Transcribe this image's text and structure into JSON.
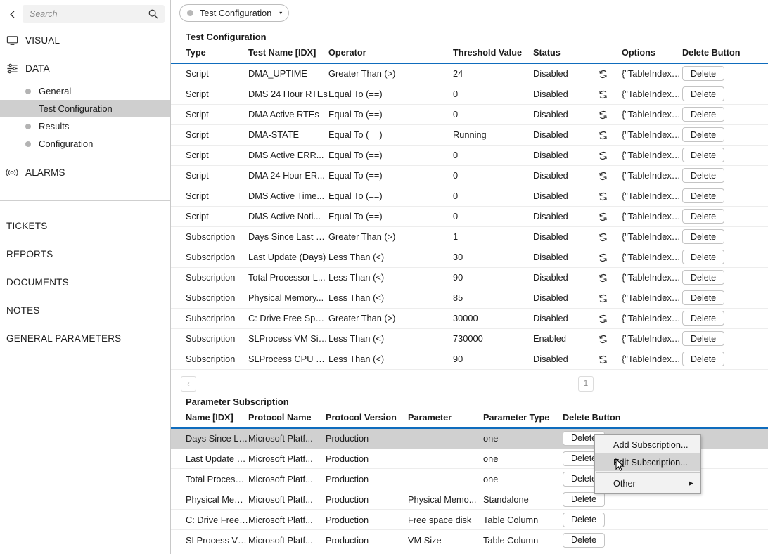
{
  "sidebar": {
    "back_icon": "chevron-left-icon",
    "search": {
      "value": "",
      "placeholder": "Search",
      "icon": "search-icon"
    },
    "sections": [
      {
        "label": "VISUAL",
        "icon": "monitor-icon"
      },
      {
        "label": "DATA",
        "icon": "sliders-icon"
      }
    ],
    "data_children": [
      {
        "label": "General",
        "selected": false
      },
      {
        "label": "Test Configuration",
        "selected": true
      },
      {
        "label": "Results",
        "selected": false
      },
      {
        "label": "Configuration",
        "selected": false
      }
    ],
    "alarms": {
      "label": "ALARMS",
      "icon": "alarm-icon"
    },
    "flat_items": [
      {
        "label": "TICKETS"
      },
      {
        "label": "REPORTS"
      },
      {
        "label": "DOCUMENTS"
      },
      {
        "label": "NOTES"
      },
      {
        "label": "GENERAL PARAMETERS"
      }
    ]
  },
  "topbar": {
    "pill_label": "Test Configuration",
    "pill_caret": "▾"
  },
  "test_configuration": {
    "title": "Test Configuration",
    "columns": [
      "Type",
      "Test Name [IDX]",
      "Operator",
      "Threshold Value",
      "Status",
      "",
      "Options",
      "Delete Button"
    ],
    "delete_label": "Delete",
    "options_value": "{\"TableIndexFilt...",
    "refresh_icon": "refresh-icon",
    "rows": [
      {
        "type": "Script",
        "name": "DMA_UPTIME",
        "operator": "Greater Than (>)",
        "threshold": "24",
        "status": "Disabled"
      },
      {
        "type": "Script",
        "name": "DMS 24 Hour RTEs",
        "operator": "Equal To (==)",
        "threshold": "0",
        "status": "Disabled"
      },
      {
        "type": "Script",
        "name": "DMA Active RTEs",
        "operator": "Equal To (==)",
        "threshold": "0",
        "status": "Disabled"
      },
      {
        "type": "Script",
        "name": "DMA-STATE",
        "operator": "Equal To (==)",
        "threshold": "Running",
        "status": "Disabled"
      },
      {
        "type": "Script",
        "name": "DMS Active ERR...",
        "operator": "Equal To (==)",
        "threshold": "0",
        "status": "Disabled"
      },
      {
        "type": "Script",
        "name": "DMA 24 Hour ER...",
        "operator": "Equal To (==)",
        "threshold": "0",
        "status": "Disabled"
      },
      {
        "type": "Script",
        "name": "DMS Active Time...",
        "operator": "Equal To (==)",
        "threshold": "0",
        "status": "Disabled"
      },
      {
        "type": "Script",
        "name": "DMS Active Noti...",
        "operator": "Equal To (==)",
        "threshold": "0",
        "status": "Disabled"
      },
      {
        "type": "Subscription",
        "name": "Days Since Last R...",
        "operator": "Greater Than (>)",
        "threshold": "1",
        "status": "Disabled"
      },
      {
        "type": "Subscription",
        "name": "Last Update (Days)",
        "operator": "Less Than (<)",
        "threshold": "30",
        "status": "Disabled"
      },
      {
        "type": "Subscription",
        "name": "Total Processor L...",
        "operator": "Less Than (<)",
        "threshold": "90",
        "status": "Disabled"
      },
      {
        "type": "Subscription",
        "name": "Physical Memory...",
        "operator": "Less Than (<)",
        "threshold": "85",
        "status": "Disabled"
      },
      {
        "type": "Subscription",
        "name": "C: Drive Free Space",
        "operator": "Greater Than (>)",
        "threshold": "30000",
        "status": "Disabled"
      },
      {
        "type": "Subscription",
        "name": "SLProcess VM Siz...",
        "operator": "Less Than (<)",
        "threshold": "730000",
        "status": "Enabled"
      },
      {
        "type": "Subscription",
        "name": "SLProcess CPU %...",
        "operator": "Less Than (<)",
        "threshold": "90",
        "status": "Disabled"
      }
    ],
    "pagination": {
      "prev": "‹",
      "page": "1"
    }
  },
  "parameter_subscription": {
    "title": "Parameter Subscription",
    "columns": [
      "Name [IDX]",
      "Protocol Name",
      "Protocol Version",
      "Parameter",
      "Parameter Type",
      "Delete Button"
    ],
    "delete_label": "Delete",
    "rows": [
      {
        "name": "Days Since Last...",
        "protocol": "Microsoft Platf...",
        "version": "Production",
        "parameter": "",
        "ptype": "one",
        "selected": true
      },
      {
        "name": "Last Update (D...",
        "protocol": "Microsoft Platf...",
        "version": "Production",
        "parameter": "",
        "ptype": "one",
        "selected": false
      },
      {
        "name": "Total Processor...",
        "protocol": "Microsoft Platf...",
        "version": "Production",
        "parameter": "",
        "ptype": "one",
        "selected": false
      },
      {
        "name": "Physical Memo...",
        "protocol": "Microsoft Platf...",
        "version": "Production",
        "parameter": "Physical Memo...",
        "ptype": "Standalone",
        "selected": false
      },
      {
        "name": "C: Drive Free S...",
        "protocol": "Microsoft Platf...",
        "version": "Production",
        "parameter": "Free space disk",
        "ptype": "Table Column",
        "selected": false
      },
      {
        "name": "SLProcess VM...",
        "protocol": "Microsoft Platf...",
        "version": "Production",
        "parameter": "VM Size",
        "ptype": "Table Column",
        "selected": false
      }
    ]
  },
  "context_menu": {
    "items": [
      {
        "label": "Add Subscription...",
        "highlighted": false,
        "submenu": false
      },
      {
        "label": "Edit Subscription...",
        "highlighted": true,
        "submenu": false
      },
      {
        "label": "Other",
        "highlighted": false,
        "submenu": true
      }
    ],
    "submenu_arrow": "▶"
  },
  "colors": {
    "accent": "#0f6cbd",
    "selection": "#d0d0d0",
    "menu_bg": "#f2f2f2",
    "menu_highlight": "#d4d4d4"
  }
}
